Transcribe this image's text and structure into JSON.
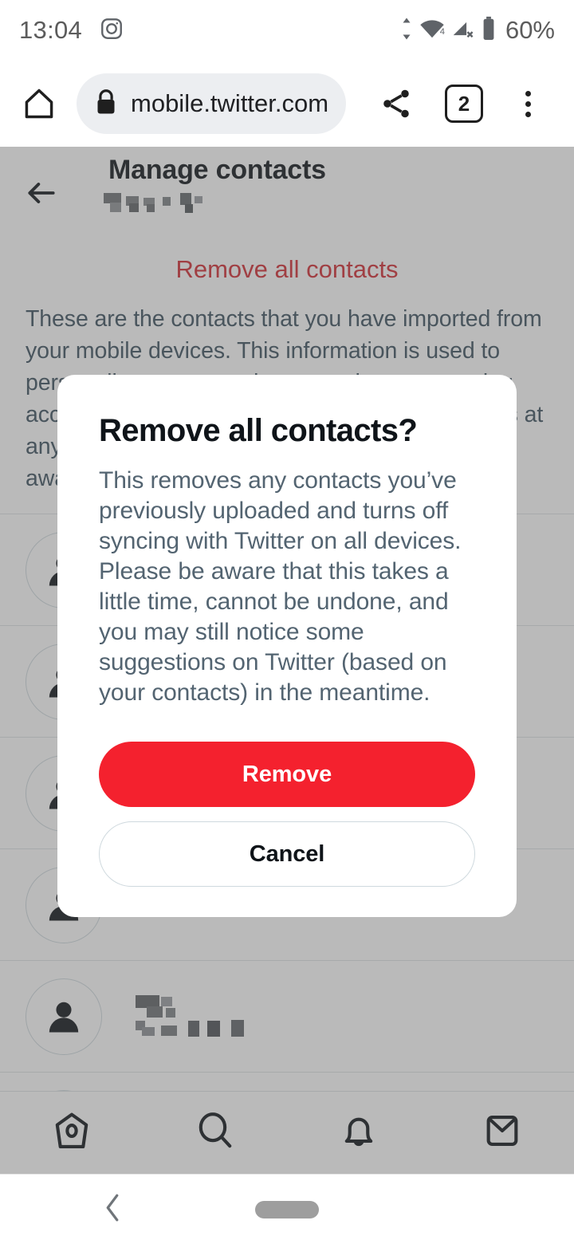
{
  "statusbar": {
    "time": "13:04",
    "battery_text": "60%",
    "wifi_label": "4",
    "icons": [
      "instagram-icon",
      "data-transfer-icon",
      "wifi-icon",
      "cellular-no-sim-icon",
      "battery-icon"
    ]
  },
  "browser": {
    "url": "mobile.twitter.com",
    "tab_count": "2",
    "home_label": "Home",
    "share_label": "Share",
    "menu_label": "More options"
  },
  "page": {
    "title": "Manage contacts",
    "handle_redacted": "",
    "remove_all_link": "Remove all contacts",
    "description": "These are the contacts that you have imported from your mobile devices. This information is used to personalize your experience, such as suggesting accounts to follow. You can remove your contacts at any time, and turn off syncing, below. Please be aware that this may take some time.",
    "contacts": [
      {
        "name_redacted": "",
        "detail_redacted": ""
      },
      {
        "name_redacted": "",
        "detail_redacted": ""
      },
      {
        "name_redacted": "",
        "detail_redacted": ""
      },
      {
        "name_redacted": "",
        "detail_redacted": ""
      },
      {
        "name_redacted": "",
        "detail_redacted": ""
      },
      {
        "name_redacted": "",
        "detail_redacted": ""
      }
    ],
    "bottom_nav": [
      {
        "name": "home-icon",
        "label": "Home"
      },
      {
        "name": "search-icon",
        "label": "Search"
      },
      {
        "name": "bell-icon",
        "label": "Notifications"
      },
      {
        "name": "mail-icon",
        "label": "Messages"
      }
    ]
  },
  "modal": {
    "title": "Remove all contacts?",
    "body": "This removes any contacts you’ve previously uploaded and turns off syncing with Twitter on all devices. Please be aware that this takes a little time, cannot be undone, and you may still notice some suggestions on Twitter (based on your contacts) in the meantime.",
    "confirm_label": "Remove",
    "cancel_label": "Cancel"
  },
  "colors": {
    "danger": "#f4212e",
    "danger_link": "#d22b33",
    "text_primary": "#0f1419",
    "text_secondary": "#536471",
    "border": "#cfd9de",
    "overlay": "#5b5b5b"
  },
  "gesture_nav": {
    "back_label": "Back",
    "home_label": "Home"
  }
}
